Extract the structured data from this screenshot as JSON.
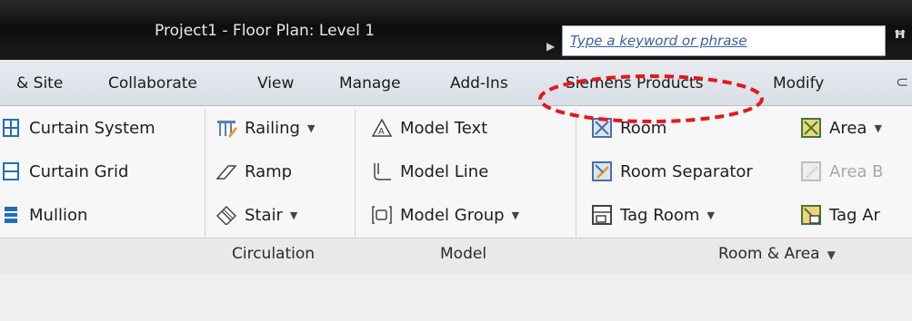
{
  "window": {
    "title": "Project1 - Floor Plan: Level 1"
  },
  "search": {
    "placeholder": "Type a keyword or phrase"
  },
  "tabs": [
    "& Site",
    "Collaborate",
    "View",
    "Manage",
    "Add-Ins",
    "Siemens Products",
    "Modify"
  ],
  "ribbon": {
    "build": [
      "Curtain System",
      "Curtain Grid",
      "Mullion"
    ],
    "circulation": [
      "Railing",
      "Ramp",
      "Stair"
    ],
    "model": [
      "Model Text",
      "Model Line",
      "Model Group"
    ],
    "room_col1": [
      "Room",
      "Room Separator",
      "Tag Room"
    ],
    "room_col2": [
      "Area",
      "Area B",
      "Tag Ar"
    ],
    "panels": {
      "circulation": "Circulation",
      "model": "Model",
      "room_area": "Room & Area"
    }
  },
  "annotation": {
    "color": "#e8161b",
    "target": "Siemens Products"
  }
}
